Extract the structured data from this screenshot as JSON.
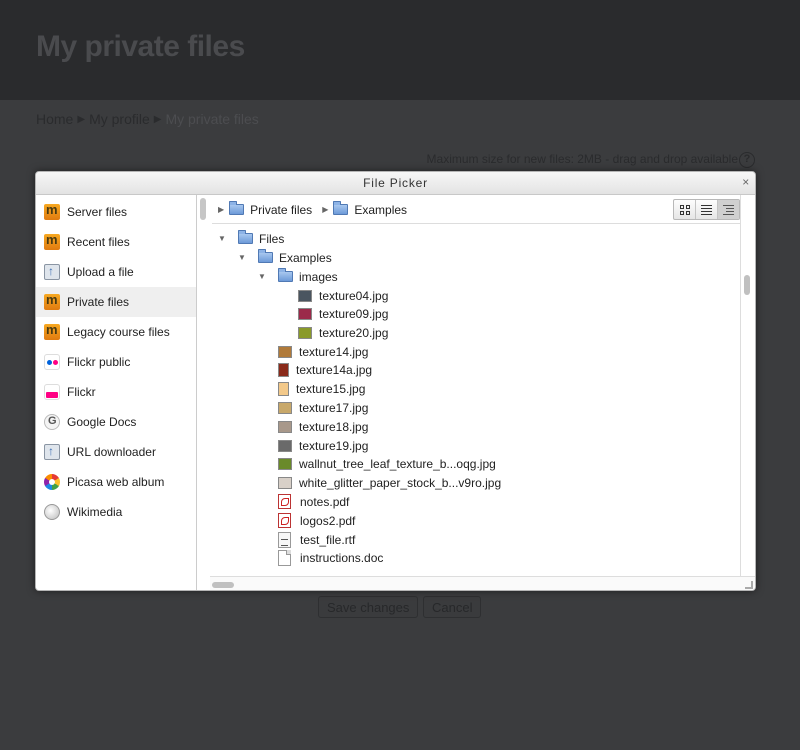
{
  "page": {
    "title": "My private files",
    "breadcrumb": [
      "Home",
      "My profile",
      "My private files"
    ],
    "max_size_text": "Maximum size for new files: 2MB - drag and drop available",
    "help_icon": "?",
    "save_label": "Save changes",
    "cancel_label": "Cancel"
  },
  "dialog": {
    "title": "File Picker",
    "close_glyph": "×",
    "repositories": [
      {
        "label": "Server files",
        "icon": "moodle-icon"
      },
      {
        "label": "Recent files",
        "icon": "moodle-icon"
      },
      {
        "label": "Upload a file",
        "icon": "upload-icon"
      },
      {
        "label": "Private files",
        "icon": "moodle-icon",
        "active": true
      },
      {
        "label": "Legacy course files",
        "icon": "moodle-icon"
      },
      {
        "label": "Flickr public",
        "icon": "flickr-public-icon"
      },
      {
        "label": "Flickr",
        "icon": "flickr-icon"
      },
      {
        "label": "Google Docs",
        "icon": "google-icon"
      },
      {
        "label": "URL downloader",
        "icon": "url-downloader-icon"
      },
      {
        "label": "Picasa web album",
        "icon": "picasa-icon"
      },
      {
        "label": "Wikimedia",
        "icon": "wikimedia-icon"
      }
    ],
    "path": [
      "Private files",
      "Examples"
    ],
    "view_modes": [
      "icons-view",
      "list-view",
      "tree-view"
    ],
    "tree": {
      "root": "Files",
      "examples": "Examples",
      "images": "images",
      "image_files": [
        {
          "name": "texture04.jpg",
          "color": "#4a5560"
        },
        {
          "name": "texture09.jpg",
          "color": "#9b2a4a"
        },
        {
          "name": "texture20.jpg",
          "color": "#8a9a2a"
        }
      ],
      "example_files": [
        {
          "name": "texture14.jpg",
          "color": "#b07a3a",
          "kind": "image"
        },
        {
          "name": "texture14a.jpg",
          "color": "#8a2a1a",
          "kind": "image-tall"
        },
        {
          "name": "texture15.jpg",
          "color": "#f3c98a",
          "kind": "image-tall"
        },
        {
          "name": "texture17.jpg",
          "color": "#c8a86a",
          "kind": "image"
        },
        {
          "name": "texture18.jpg",
          "color": "#a8988a",
          "kind": "image"
        },
        {
          "name": "texture19.jpg",
          "color": "#6a6a6a",
          "kind": "image"
        },
        {
          "name": "wallnut_tree_leaf_texture_b...oqg.jpg",
          "color": "#6a8a2a",
          "kind": "image"
        },
        {
          "name": "white_glitter_paper_stock_b...v9ro.jpg",
          "color": "#d8d0c8",
          "kind": "image"
        },
        {
          "name": "notes.pdf",
          "kind": "pdf"
        },
        {
          "name": "logos2.pdf",
          "kind": "pdf"
        },
        {
          "name": "test_file.rtf",
          "kind": "rtf"
        },
        {
          "name": "instructions.doc",
          "kind": "doc"
        }
      ]
    }
  }
}
